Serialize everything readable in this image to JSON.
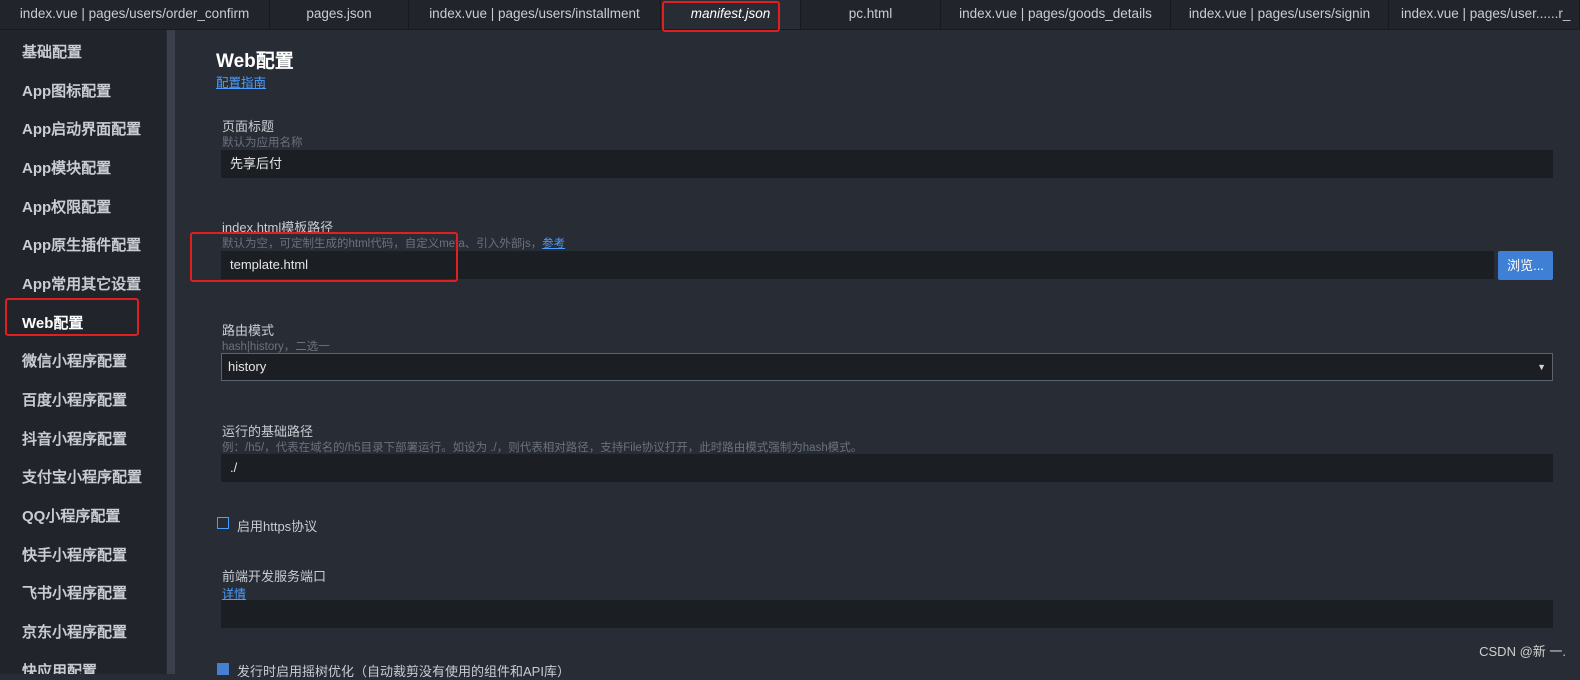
{
  "tabs": [
    {
      "label": "index.vue | pages/users/order_confirm",
      "active": false
    },
    {
      "label": "pages.json",
      "active": false
    },
    {
      "label": "index.vue | pages/users/installment",
      "active": false
    },
    {
      "label": "manifest.json",
      "active": true
    },
    {
      "label": "pc.html",
      "active": false
    },
    {
      "label": "index.vue | pages/goods_details",
      "active": false
    },
    {
      "label": "index.vue | pages/users/signin",
      "active": false
    },
    {
      "label": "index.vue | pages/user......r_",
      "active": false
    }
  ],
  "sidebar": {
    "items": [
      {
        "label": "基础配置"
      },
      {
        "label": "App图标配置"
      },
      {
        "label": "App启动界面配置"
      },
      {
        "label": "App模块配置"
      },
      {
        "label": "App权限配置"
      },
      {
        "label": "App原生插件配置"
      },
      {
        "label": "App常用其它设置"
      },
      {
        "label": "Web配置",
        "active": true
      },
      {
        "label": "微信小程序配置"
      },
      {
        "label": "百度小程序配置"
      },
      {
        "label": "抖音小程序配置"
      },
      {
        "label": "支付宝小程序配置"
      },
      {
        "label": "QQ小程序配置"
      },
      {
        "label": "快手小程序配置"
      },
      {
        "label": "飞书小程序配置"
      },
      {
        "label": "京东小程序配置"
      },
      {
        "label": "快应用配置"
      }
    ]
  },
  "main": {
    "title": "Web配置",
    "guide_link": "配置指南",
    "page_title_field": {
      "label": "页面标题",
      "hint": "默认为应用名称",
      "value": "先享后付"
    },
    "template_field": {
      "label": "index.html模板路径",
      "hint": "默认为空，可定制生成的html代码，自定义meta、引入外部js，",
      "hint_link": "参考",
      "value": "template.html",
      "browse_label": "浏览..."
    },
    "router_field": {
      "label": "路由模式",
      "hint": "hash|history，二选一",
      "value": "history"
    },
    "base_path_field": {
      "label": "运行的基础路径",
      "hint": "例：/h5/，代表在域名的/h5目录下部署运行。如设为 ./，则代表相对路径，支持File协议打开，此时路由模式强制为hash模式。",
      "value": "./"
    },
    "https_checkbox": {
      "label": "启用https协议",
      "checked": false
    },
    "dev_port_field": {
      "label": "前端开发服务端口",
      "link": "详情",
      "value": ""
    },
    "treeshake_checkbox": {
      "label": "发行时启用摇树优化（自动裁剪没有使用的组件和API库）",
      "checked": true
    }
  },
  "watermark": "CSDN @新 一.",
  "colors": {
    "highlight_box": "#e02020",
    "link": "#4a9eff",
    "button": "#3f7fd6"
  }
}
